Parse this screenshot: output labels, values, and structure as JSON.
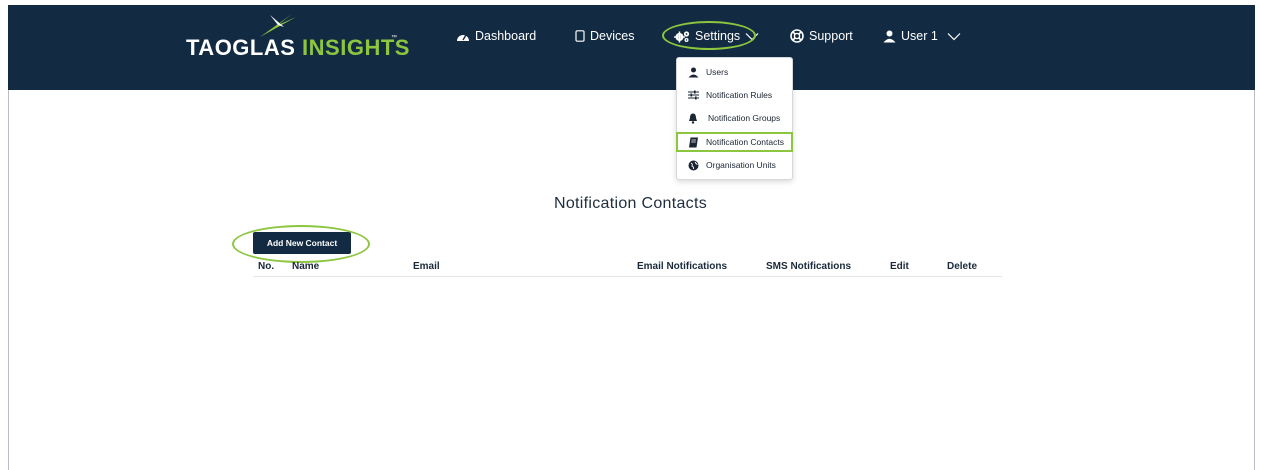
{
  "logo": {
    "part1": "TAOGLAS",
    "part2": "INSIGHTS",
    "tm": "™"
  },
  "nav": {
    "dashboard": "Dashboard",
    "devices": "Devices",
    "settings": "Settings",
    "support": "Support",
    "user": "User 1"
  },
  "settings_menu": {
    "items": [
      {
        "label": "Users",
        "icon": "user-icon"
      },
      {
        "label": "Notification Rules",
        "icon": "sliders-icon"
      },
      {
        "label": "Notification Groups",
        "icon": "bell-icon"
      },
      {
        "label": "Notification Contacts",
        "icon": "address-book-icon",
        "active": true
      },
      {
        "label": "Organisation Units",
        "icon": "globe-icon"
      }
    ]
  },
  "page": {
    "title": "Notification Contacts",
    "add_button": "Add New Contact"
  },
  "table": {
    "columns": [
      "No.",
      "Name",
      "Email",
      "Email Notifications",
      "SMS Notifications",
      "Edit",
      "Delete"
    ],
    "rows": []
  },
  "colors": {
    "header_bg": "#132b42",
    "accent_green": "#8cc63f",
    "text_dark": "#1b2a3a"
  }
}
